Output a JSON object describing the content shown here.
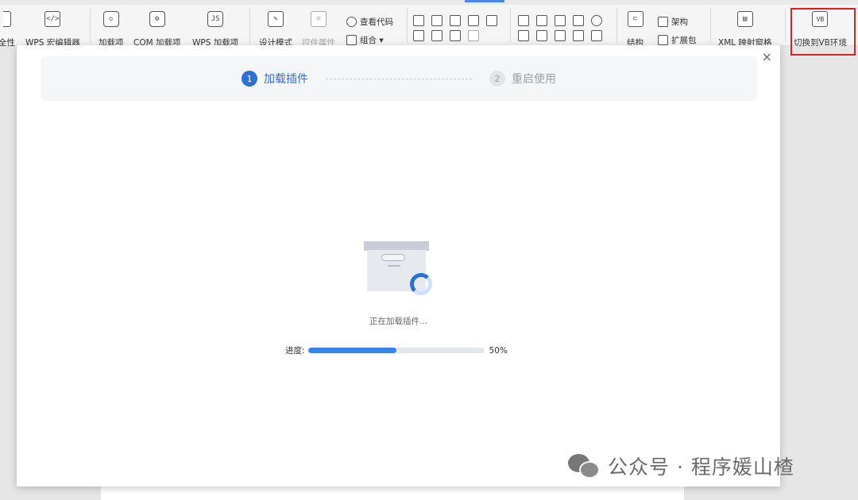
{
  "ribbon": {
    "items": [
      {
        "label": "全性",
        "icon": "shield-partial-icon"
      },
      {
        "label": "WPS 宏编辑器",
        "icon": "macro-editor-icon"
      },
      {
        "label": "加载项",
        "icon": "cube-icon"
      },
      {
        "label": "COM 加载项",
        "icon": "cube-gear-icon"
      },
      {
        "label": "WPS 加载项",
        "icon": "cube-js-icon"
      },
      {
        "label": "设计模式",
        "icon": "design-mode-icon"
      },
      {
        "label": "控件属性",
        "icon": "control-properties-icon",
        "disabled": true
      },
      {
        "label": "结构",
        "icon": "structure-icon"
      },
      {
        "label": "XML 映射窗格",
        "icon": "xml-mapping-icon"
      },
      {
        "label": "切换到VB环境",
        "icon": "vb-switch-icon",
        "highlighted": true
      }
    ],
    "view_code": "查看代码",
    "combine": "组合 ▾",
    "architecture": "架构",
    "expansion_pack": "扩展包",
    "vb_badge": "VB"
  },
  "dialog": {
    "close_label": "×",
    "steps": [
      {
        "number": "1",
        "label": "加载插件",
        "state": "active"
      },
      {
        "number": "2",
        "label": "重启使用",
        "state": "inactive"
      }
    ],
    "status_text": "正在加载插件...",
    "progress": {
      "label": "进度:",
      "value": 50,
      "value_text": "50%"
    }
  },
  "watermark": {
    "text": "公众号 · 程序媛山楂",
    "icon": "wechat-icon"
  },
  "colors": {
    "accent": "#2d6fd6",
    "highlight_border": "#e02020"
  }
}
